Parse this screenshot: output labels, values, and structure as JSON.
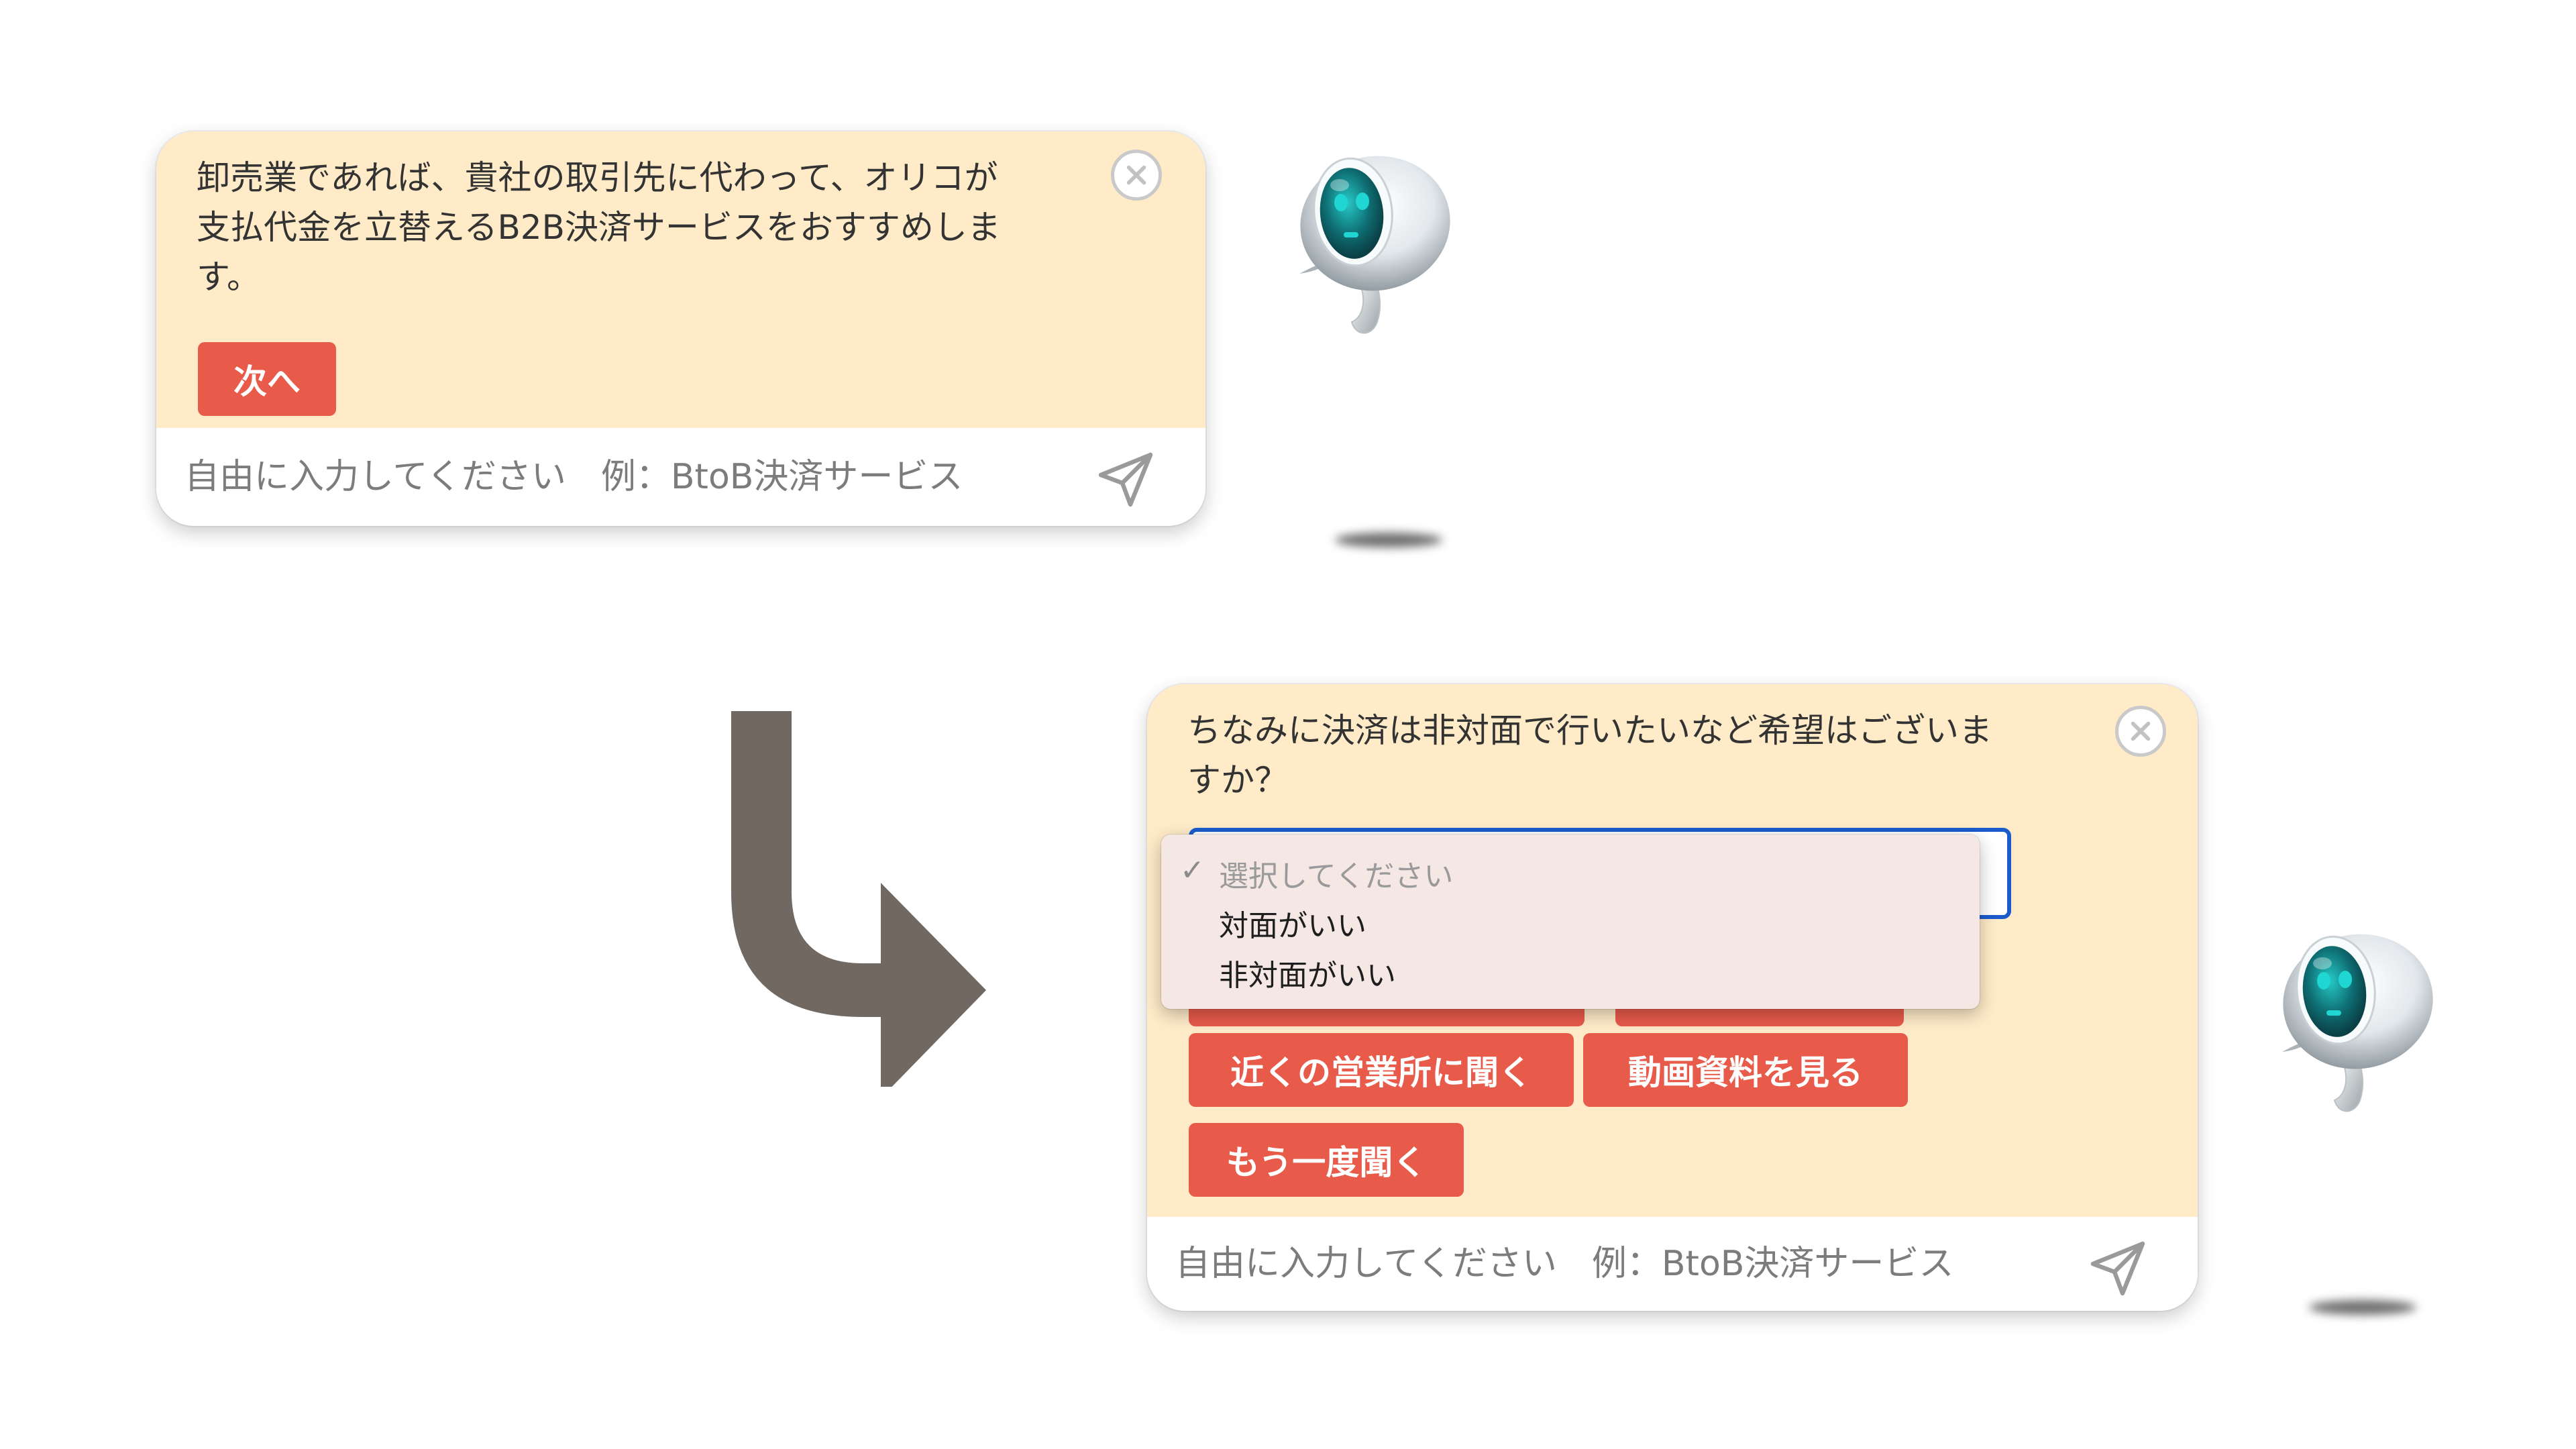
{
  "panel1": {
    "message_lines": [
      "卸売業であれば、貴社の取引先に代わって、オリコが",
      "支払代金を立替えるB2B決済サービスをおすすめしま",
      "す。"
    ],
    "next_button": "次へ",
    "input_placeholder": "自由に入力してください　例：BtoB決済サービス"
  },
  "panel2": {
    "message_lines": [
      "ちなみに決済は非対面で行いたいなど希望はございま",
      "すか？"
    ],
    "dropdown_options": [
      "選択してください",
      "対面がいい",
      "非対面がいい"
    ],
    "buttons": [
      "近くの営業所に聞く",
      "動画資料を見る",
      "もう一度聞く"
    ],
    "input_placeholder": "自由に入力してください　例：BtoB決済サービス"
  },
  "icons": {
    "close": "close-icon",
    "send": "paper-plane-icon",
    "arrow": "bent-arrow-down-right-icon",
    "mascot": "robot-mascot"
  },
  "colors": {
    "panel_bg": "#ffebc8",
    "button_red": "#e85a4a",
    "arrow_gray": "#716862",
    "select_focus_blue": "#1a5ccc",
    "robot_eye_teal": "#1fd6d2"
  }
}
